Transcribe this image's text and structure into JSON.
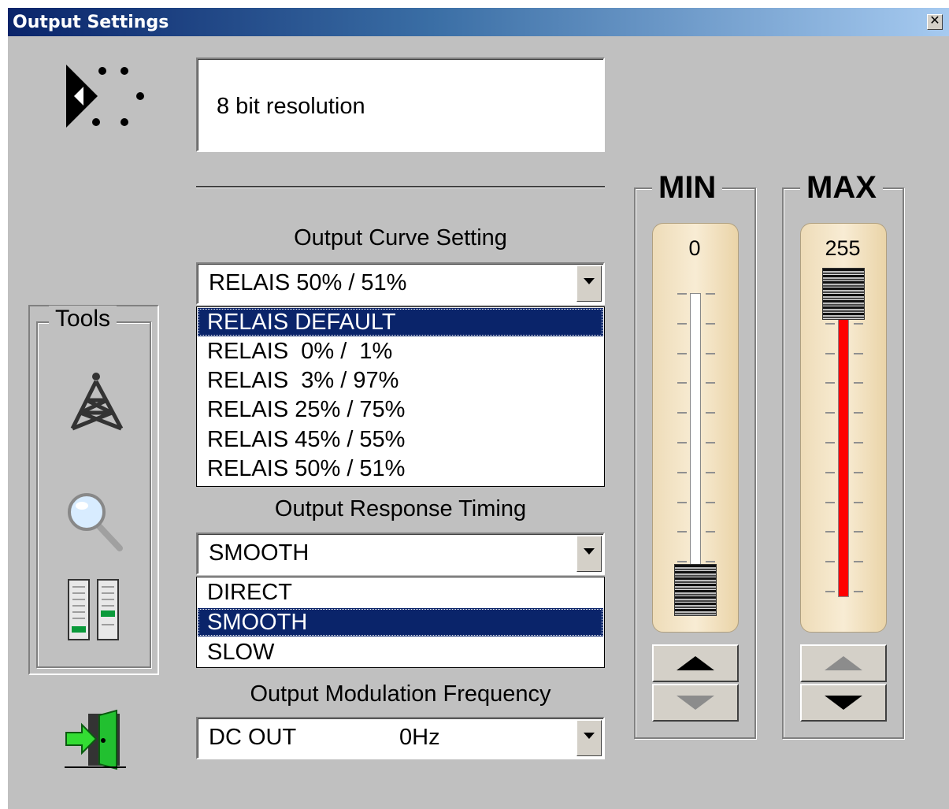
{
  "window": {
    "title": "Output Settings",
    "close_glyph": "✕"
  },
  "info": {
    "text": "8 bit resolution"
  },
  "curve": {
    "label": "Output Curve Setting",
    "selected": "RELAIS 50% / 51%",
    "options": [
      "RELAIS DEFAULT",
      "RELAIS  0% /  1%",
      "RELAIS  3% / 97%",
      "RELAIS 25% / 75%",
      "RELAIS 45% / 55%",
      "RELAIS 50% / 51%"
    ],
    "highlighted_index": 0
  },
  "timing": {
    "label": "Output Response Timing",
    "selected": "SMOOTH",
    "options": [
      "DIRECT",
      "SMOOTH",
      "SLOW"
    ],
    "highlighted_index": 1
  },
  "modulation": {
    "label": "Output Modulation Frequency",
    "selected_name": "DC OUT",
    "selected_freq": "0Hz"
  },
  "tools": {
    "label": "Tools",
    "icons": [
      "tower-icon",
      "magnifier-icon",
      "faders-icon"
    ]
  },
  "min": {
    "title": "MIN",
    "value": "0",
    "level": 0,
    "up_enabled": true,
    "down_enabled": false
  },
  "max": {
    "title": "MAX",
    "value": "255",
    "level": 1,
    "up_enabled": false,
    "down_enabled": true
  },
  "colors": {
    "title_start": "#0a246a",
    "title_end": "#a6caf0",
    "selection": "#0a246a",
    "level_bar": "#ff0000",
    "background": "#c0c0c0"
  }
}
